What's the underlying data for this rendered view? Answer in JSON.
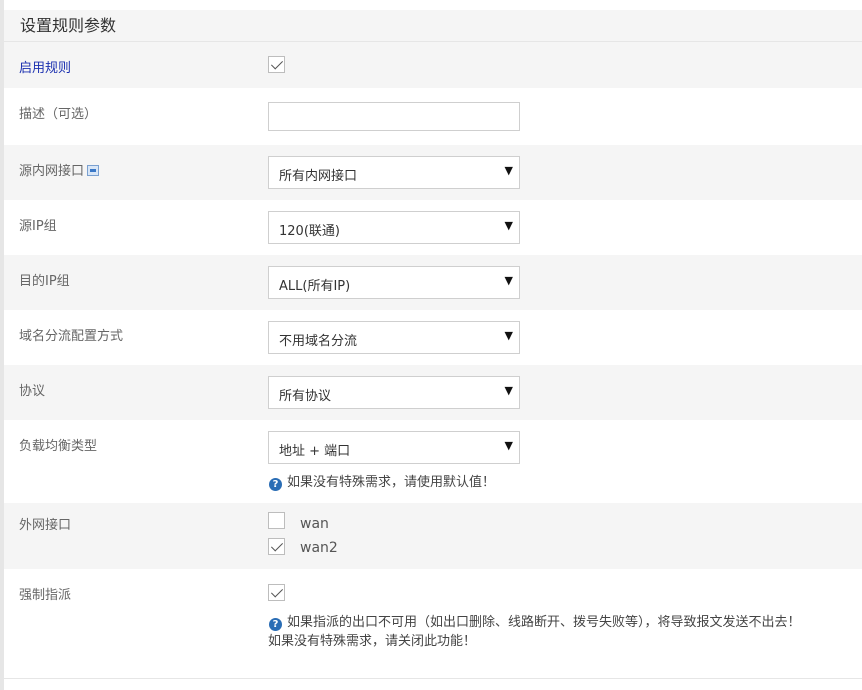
{
  "section": {
    "title": "设置规则参数"
  },
  "fields": {
    "enable": {
      "label": "启用规则",
      "checked": true
    },
    "description": {
      "label": "描述（可选）",
      "value": ""
    },
    "src_interface": {
      "label": "源内网接口",
      "value": "所有内网接口"
    },
    "src_ip_group": {
      "label": "源IP组",
      "value": "120(联通)"
    },
    "dst_ip_group": {
      "label": "目的IP组",
      "value": "ALL(所有IP)"
    },
    "domain_mode": {
      "label": "域名分流配置方式",
      "value": "不用域名分流"
    },
    "protocol": {
      "label": "协议",
      "value": "所有协议"
    },
    "lb_type": {
      "label": "负载均衡类型",
      "value": "地址 + 端口",
      "hint": "如果没有特殊需求，请使用默认值！"
    },
    "wan_interface": {
      "label": "外网接口",
      "options": [
        {
          "name": "wan",
          "checked": false
        },
        {
          "name": "wan2",
          "checked": true
        }
      ]
    },
    "force_assign": {
      "label": "强制指派",
      "checked": true,
      "hint_line1": "如果指派的出口不可用（如出口删除、线路断开、拨号失败等），将导致报文发送不出去！",
      "hint_line2": "如果没有特殊需求，请关闭此功能！"
    }
  },
  "icons": {
    "dropdown_arrow": "▼",
    "help": "?"
  }
}
